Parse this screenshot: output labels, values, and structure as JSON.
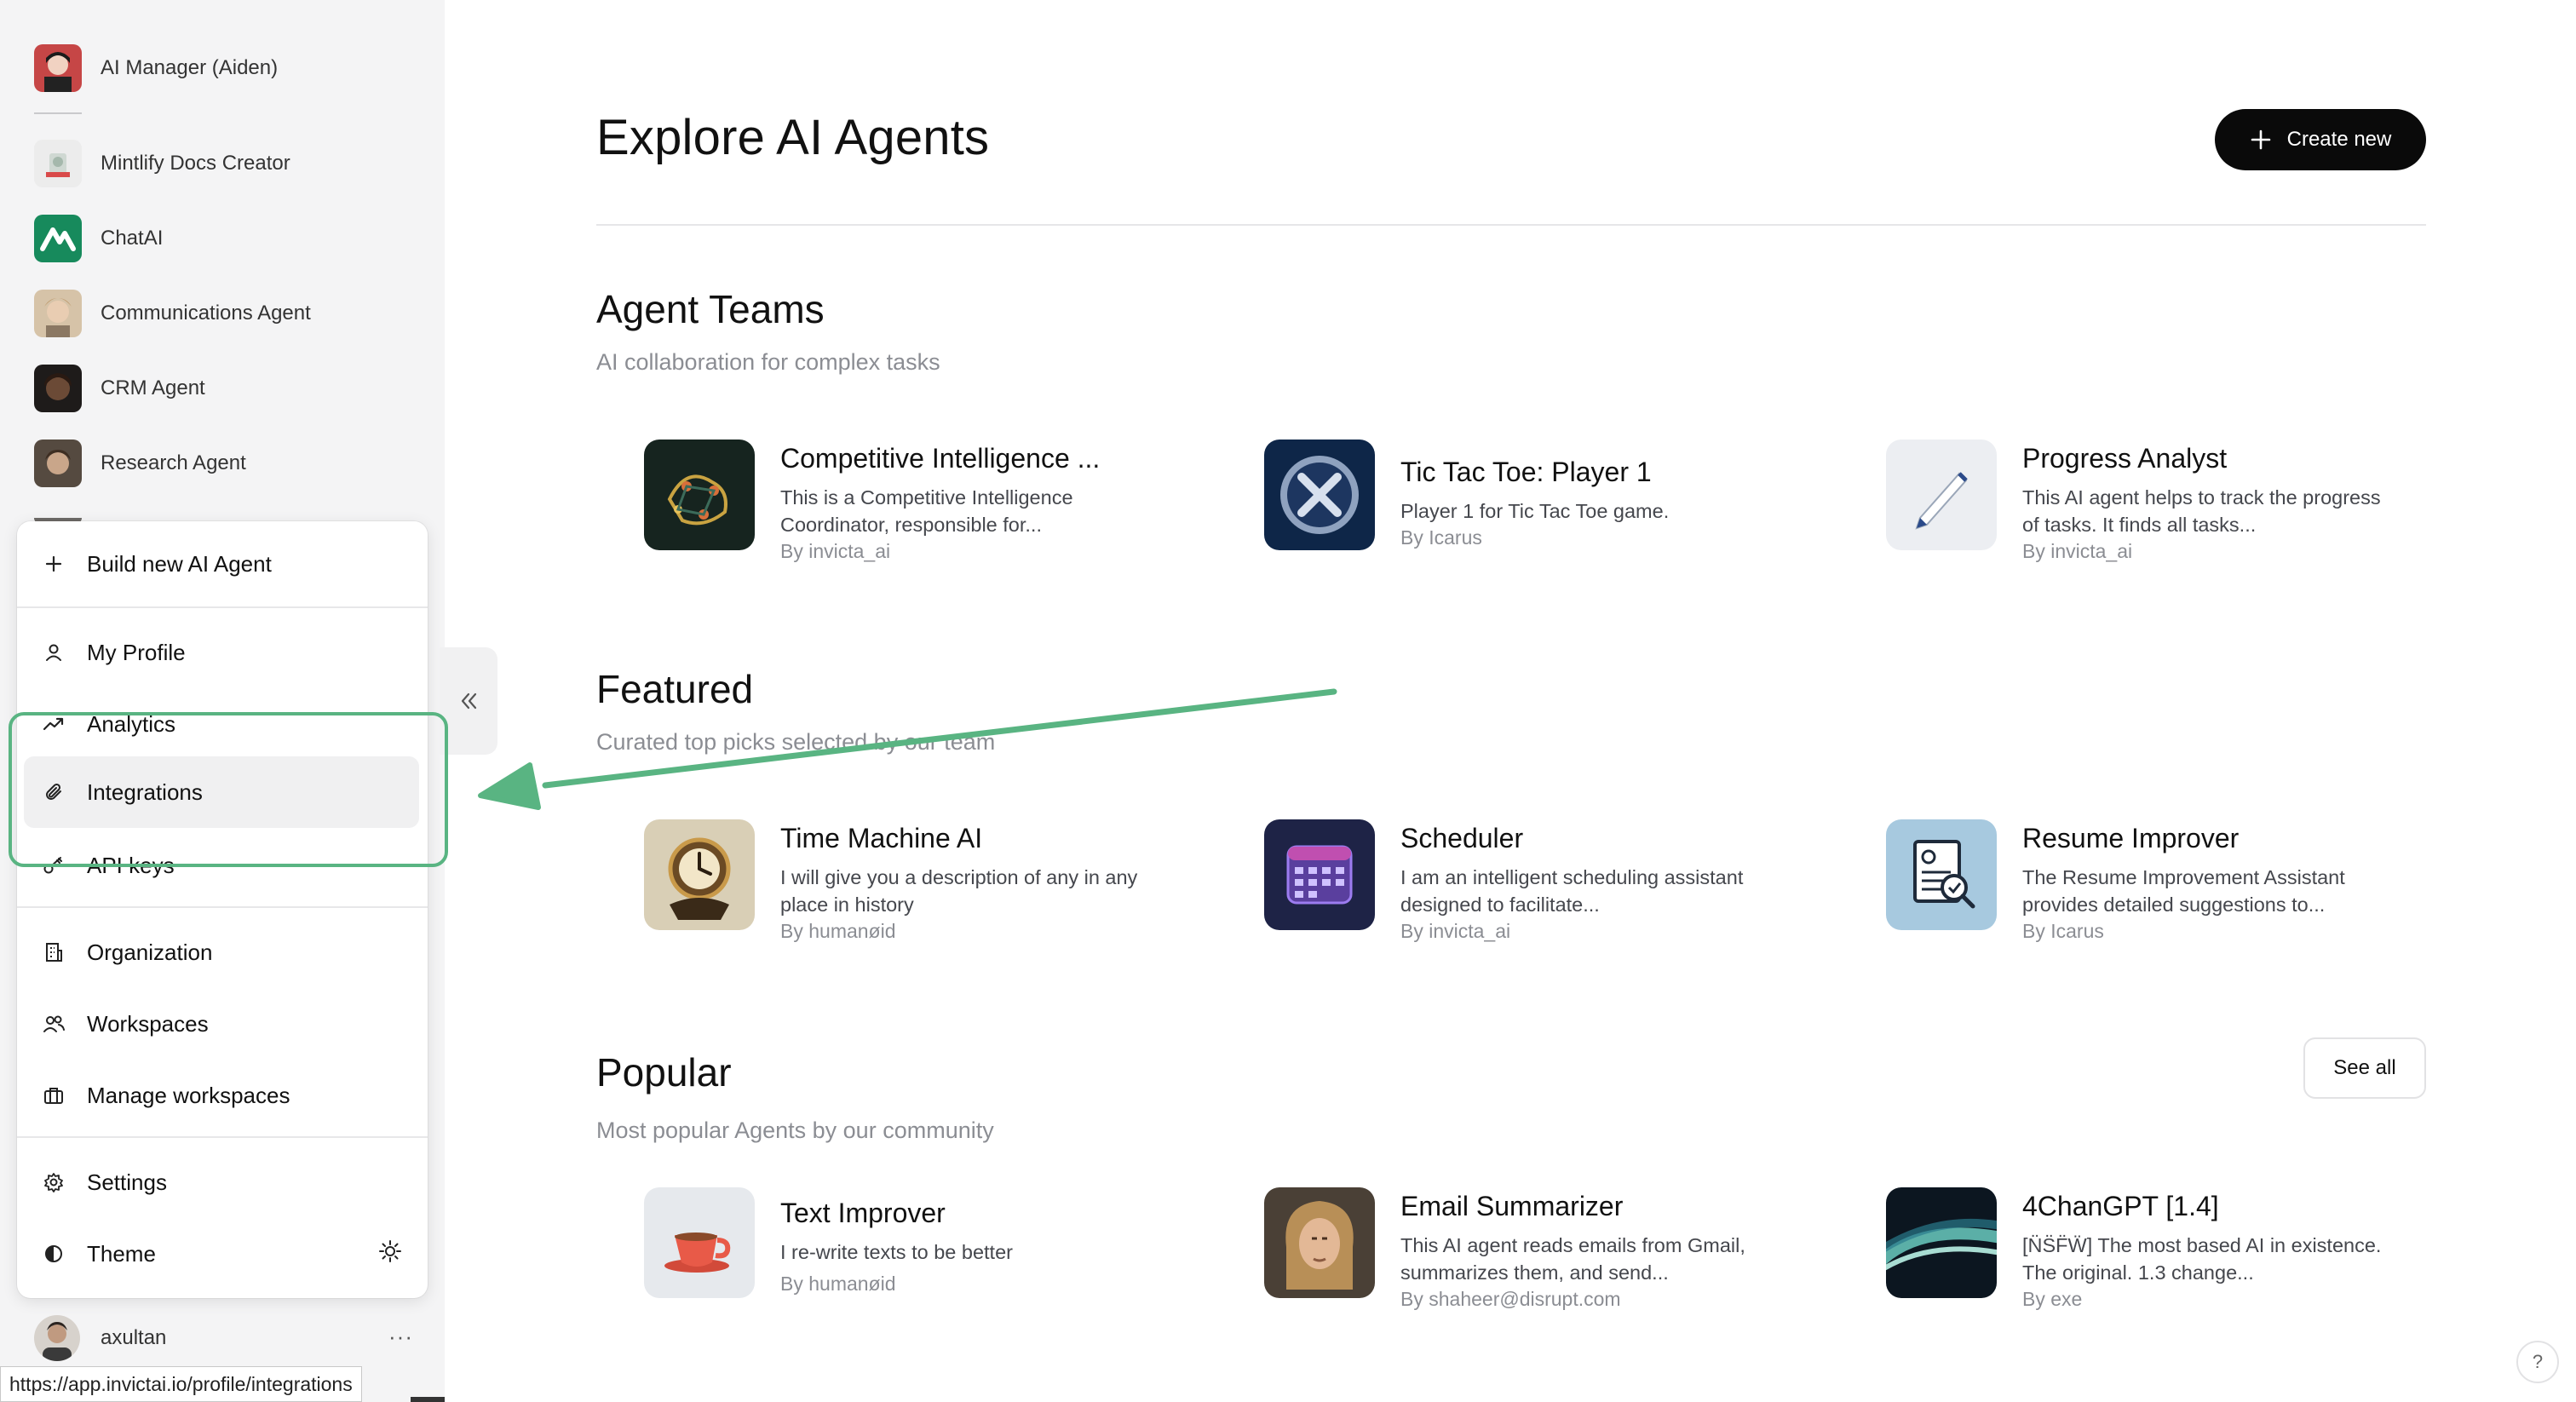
{
  "sidebar": {
    "agents": [
      {
        "label": "AI Manager (Aiden)"
      },
      {
        "label": "Mintlify Docs Creator"
      },
      {
        "label": "ChatAI"
      },
      {
        "label": "Communications Agent"
      },
      {
        "label": "CRM Agent"
      },
      {
        "label": "Research Agent"
      }
    ],
    "user": {
      "name": "axultan",
      "more": "···"
    }
  },
  "menu": {
    "build_new": "Build new AI Agent",
    "my_profile": "My Profile",
    "analytics": "Analytics",
    "integrations": "Integrations",
    "api_keys": "API keys",
    "organization": "Organization",
    "workspaces": "Workspaces",
    "manage_workspaces": "Manage workspaces",
    "settings": "Settings",
    "theme": "Theme"
  },
  "status_url": "https://app.invictai.io/profile/integrations",
  "main": {
    "title": "Explore AI Agents",
    "create_label": "Create new",
    "see_all": "See all",
    "help": "?",
    "sections": {
      "teams": {
        "title": "Agent Teams",
        "subtitle": "AI collaboration for complex tasks",
        "cards": [
          {
            "title": "Competitive Intelligence ...",
            "desc": "This is a Competitive Intelligence Coordinator, responsible for...",
            "by": "By invicta_ai"
          },
          {
            "title": "Tic Tac Toe: Player 1",
            "desc": "Player 1 for Tic Tac Toe game.",
            "by": "By Icarus"
          },
          {
            "title": "Progress Analyst",
            "desc": "This AI agent helps to track the progress of tasks. It finds all tasks...",
            "by": "By invicta_ai"
          }
        ]
      },
      "featured": {
        "title": "Featured",
        "subtitle": "Curated top picks selected by our team",
        "cards": [
          {
            "title": "Time Machine AI",
            "desc": "I will give you a description of any in any place in history",
            "by": "By humanøid"
          },
          {
            "title": "Scheduler",
            "desc": "I am an intelligent scheduling assistant designed to facilitate...",
            "by": "By invicta_ai"
          },
          {
            "title": "Resume Improver",
            "desc": "The Resume Improvement Assistant provides detailed suggestions to...",
            "by": "By Icarus"
          }
        ]
      },
      "popular": {
        "title": "Popular",
        "subtitle": "Most popular Agents by our community",
        "cards": [
          {
            "title": "Text Improver",
            "desc": "I re-write texts to be better",
            "by": "By humanøid"
          },
          {
            "title": "Email Summarizer",
            "desc": "This AI agent reads emails from Gmail, summarizes them, and send...",
            "by": "By shaheer@disrupt.com"
          },
          {
            "title": "4ChanGPT [1.4]",
            "desc": "[N̈S̈F̈Ẅ] The most based AI in existence. The original. 1.3 change...",
            "by": "By exe"
          }
        ]
      }
    }
  },
  "colors": {
    "annotation": "#59b482",
    "accent": "#0a0a0a"
  }
}
